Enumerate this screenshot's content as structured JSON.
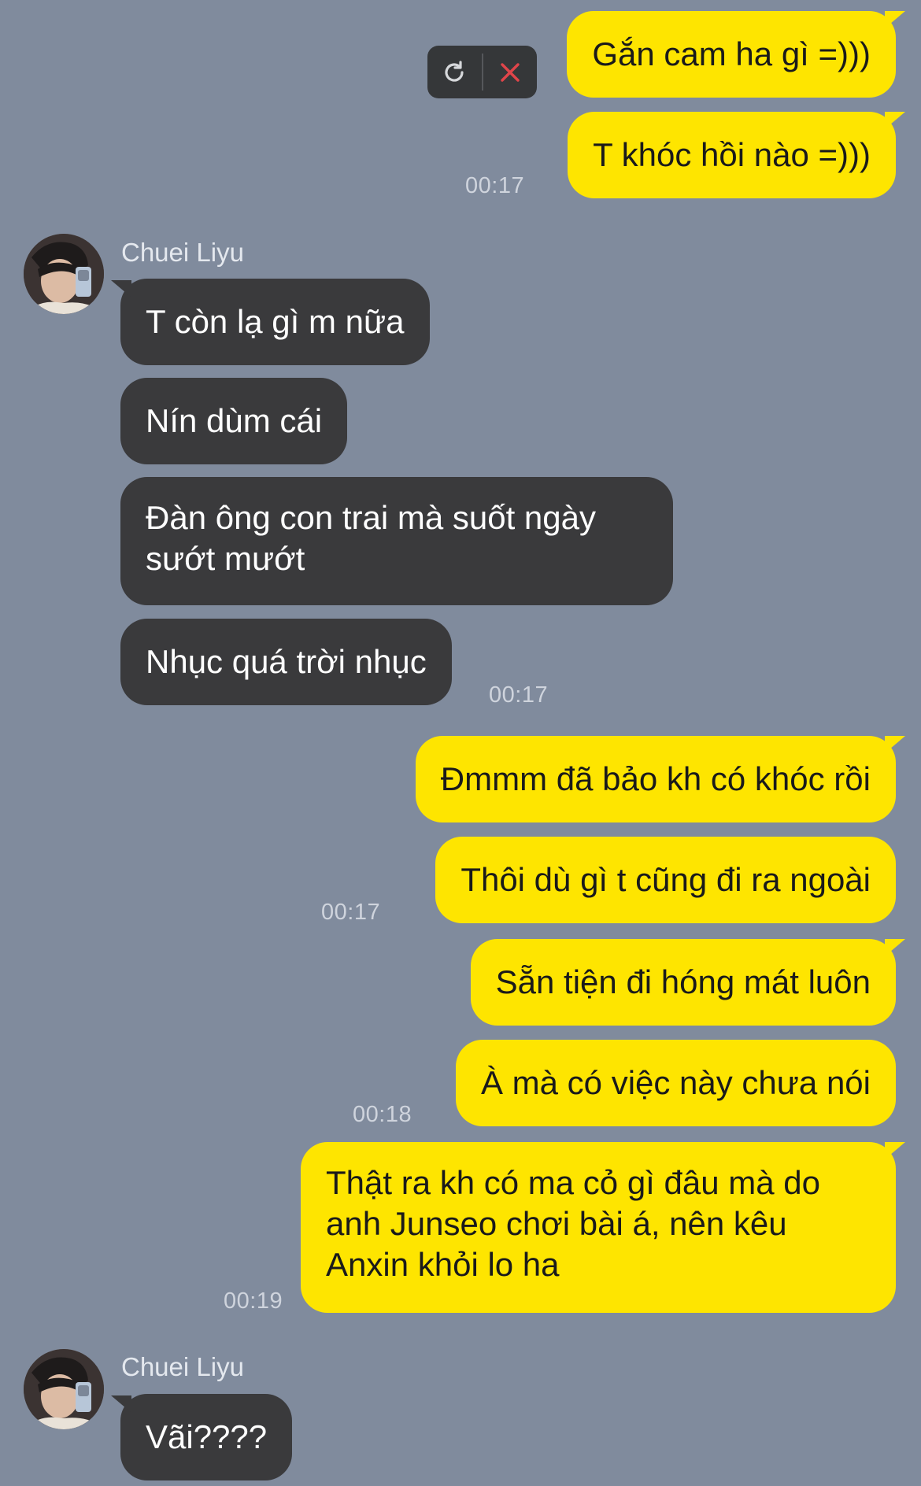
{
  "chat": {
    "retry_actions": {
      "retry_icon": "refresh-icon",
      "delete_icon": "close-icon"
    },
    "messages": [
      {
        "text": "Gắn cam ha gì =)))"
      },
      {
        "text": "T khóc hồi nào =)))"
      },
      {
        "time": "00:17"
      },
      {
        "sender": "Chuei Liyu"
      },
      {
        "text": "T còn lạ gì m nữa"
      },
      {
        "text": "Nín dùm cái"
      },
      {
        "text": "Đàn ông con trai mà suốt ngày sướt mướt"
      },
      {
        "text": "Nhục quá trời nhục",
        "time": "00:17"
      },
      {
        "text": "Đmmm đã bảo kh có khóc rồi"
      },
      {
        "text": "Thôi dù gì t cũng đi ra ngoài",
        "time": "00:17"
      },
      {
        "text": "Sẵn tiện đi hóng mát luôn"
      },
      {
        "text": "À mà có việc này chưa nói",
        "time": "00:18"
      },
      {
        "text": "Thật ra kh có ma cỏ gì đâu mà do anh Junseo chơi bài á, nên kêu Anxin khỏi lo ha",
        "time": "00:19"
      },
      {
        "sender": "Chuei Liyu"
      },
      {
        "text": "Vãi????"
      }
    ]
  },
  "colors": {
    "background": "#808b9d",
    "outgoing_bubble": "#fee500",
    "incoming_bubble": "#3a3a3c",
    "delete_icon": "#e0454a"
  }
}
